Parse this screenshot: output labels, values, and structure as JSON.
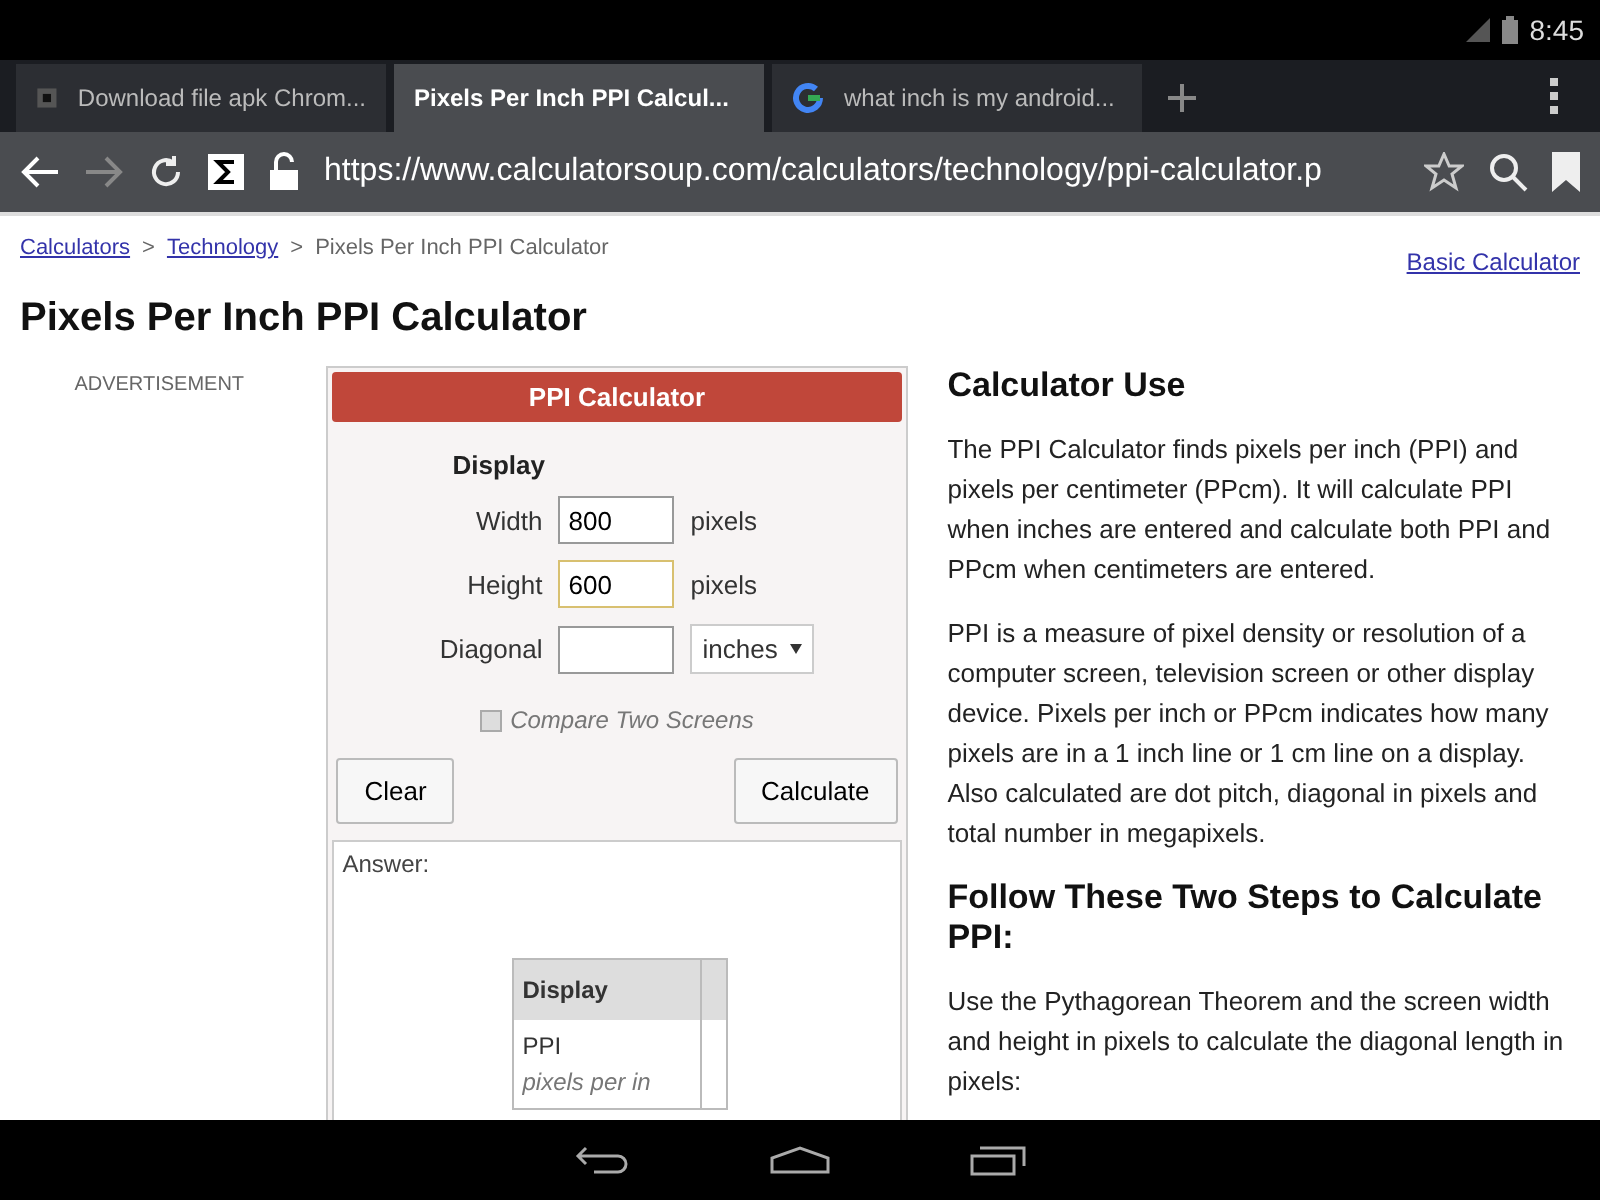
{
  "status_bar": {
    "time": "8:45"
  },
  "tabs": [
    {
      "title": "Download file apk Chrom...",
      "selected": false,
      "kind": "page"
    },
    {
      "title": "Pixels Per Inch PPI Calcul...",
      "selected": true,
      "kind": "plain"
    },
    {
      "title": "what inch is my android...",
      "selected": false,
      "kind": "google"
    }
  ],
  "address_bar": {
    "url": "https://www.calculatorsoup.com/calculators/technology/ppi-calculator.p"
  },
  "breadcrumb": [
    {
      "label": "Calculators",
      "kind": "link"
    },
    {
      "label": ">",
      "kind": "separator"
    },
    {
      "label": "Technology",
      "kind": "link"
    },
    {
      "label": ">",
      "kind": "separator"
    },
    {
      "label": "Pixels Per Inch PPI Calculator",
      "kind": "current"
    }
  ],
  "basic_calculator_link": "Basic Calculator",
  "page_title": "Pixels Per Inch PPI Calculator",
  "advertisement_label": "ADVERTISEMENT",
  "calculator": {
    "title": "PPI Calculator",
    "section": "Display",
    "fields": [
      {
        "label": "Width",
        "value": "800",
        "unit": "pixels",
        "focused": false
      },
      {
        "label": "Height",
        "value": "600",
        "unit": "pixels",
        "focused": true
      },
      {
        "label": "Diagonal",
        "unit_select": "inches"
      }
    ],
    "compare": {
      "label": "Compare Two Screens",
      "checked": false
    },
    "buttons": [
      "Clear",
      "Calculate"
    ],
    "answer_label": "Answer:",
    "answer_table": {
      "header": "Display",
      "row_title": "PPI",
      "row_subtitle": "pixels per in"
    }
  },
  "article": [
    {
      "kind": "heading",
      "text": "Calculator Use"
    },
    {
      "kind": "paragraph",
      "text": "The PPI Calculator finds pixels per inch (PPI) and pixels per centimeter (PPcm). It will calculate PPI when inches are entered and calculate both PPI and PPcm when centimeters are entered."
    },
    {
      "kind": "paragraph",
      "text": "PPI is a measure of pixel density or resolution of a computer screen, television screen or other display device. Pixels per inch or PPcm indicates how many pixels are in a 1 inch line or 1 cm line on a display. Also calculated are dot pitch, diagonal in pixels and total number in megapixels."
    },
    {
      "kind": "heading",
      "text": "Follow These Two Steps to Calculate PPI:"
    },
    {
      "kind": "paragraph",
      "text": "Use the Pythagorean Theorem and the screen width and height in pixels to calculate the diagonal length in pixels:"
    }
  ]
}
